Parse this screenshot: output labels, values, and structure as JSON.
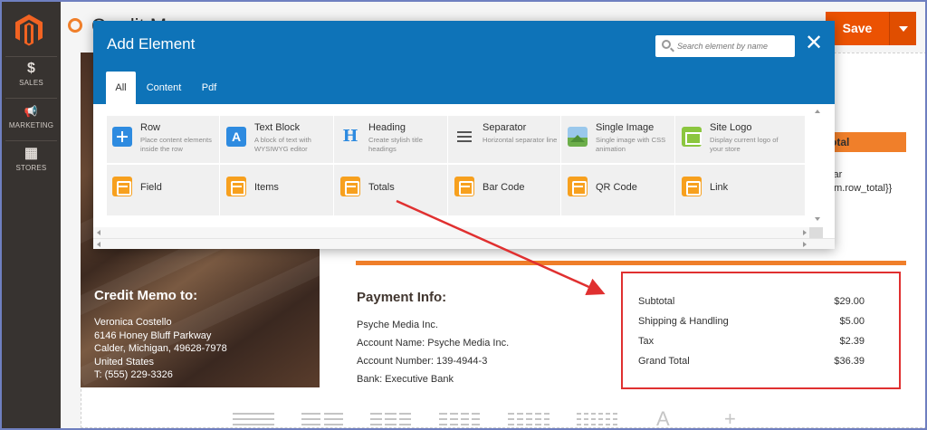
{
  "sidebar": {
    "items": [
      {
        "label": "SALES",
        "icon": "dollar-icon",
        "glyph": "$"
      },
      {
        "label": "MARKETING",
        "icon": "megaphone-icon",
        "glyph": "📢"
      },
      {
        "label": "STORES",
        "icon": "store-icon",
        "glyph": "▦"
      }
    ]
  },
  "header": {
    "title": "Credit Memo",
    "save_label": "Save"
  },
  "modal": {
    "title": "Add Element",
    "search_placeholder": "Search element by name",
    "close_glyph": "✕",
    "tabs": [
      {
        "label": "All",
        "active": true
      },
      {
        "label": "Content",
        "active": false
      },
      {
        "label": "Pdf",
        "active": false
      }
    ],
    "elements": [
      {
        "name": "Row",
        "desc": "Place content elements inside the row",
        "icon": "plus-icon"
      },
      {
        "name": "Text Block",
        "desc": "A block of text with WYSIWYG editor",
        "icon": "text-block-icon"
      },
      {
        "name": "Heading",
        "desc": "Create stylish title headings",
        "icon": "heading-icon"
      },
      {
        "name": "Separator",
        "desc": "Horizontal separator line",
        "icon": "separator-icon"
      },
      {
        "name": "Single Image",
        "desc": "Single image with CSS animation",
        "icon": "image-icon"
      },
      {
        "name": "Site Logo",
        "desc": "Display current logo of your store",
        "icon": "logo-icon"
      },
      {
        "name": "Field",
        "desc": "",
        "icon": "box-icon"
      },
      {
        "name": "Items",
        "desc": "",
        "icon": "box-icon"
      },
      {
        "name": "Totals",
        "desc": "",
        "icon": "box-icon"
      },
      {
        "name": "Bar Code",
        "desc": "",
        "icon": "box-icon"
      },
      {
        "name": "QR Code",
        "desc": "",
        "icon": "box-icon"
      },
      {
        "name": "Link",
        "desc": "",
        "icon": "box-icon"
      }
    ]
  },
  "canvas": {
    "total_tab": "otal",
    "code_lines": [
      "var",
      "em.row_total}}"
    ],
    "credit_memo_to": {
      "heading": "Credit Memo to:",
      "lines": [
        "Veronica Costello",
        "6146 Honey Bluff Parkway",
        "Calder, Michigan, 49628-7978",
        "United States",
        "T: (555) 229-3326"
      ]
    },
    "payment_info": {
      "heading": "Payment Info:",
      "lines": [
        "Psyche Media Inc.",
        "Account Name: Psyche Media Inc.",
        "Account Number: 139-4944-3",
        "Bank: Executive Bank"
      ]
    },
    "totals": [
      {
        "label": "Subtotal",
        "value": "$29.00"
      },
      {
        "label": "Shipping & Handling",
        "value": "$5.00"
      },
      {
        "label": "Tax",
        "value": "$2.39"
      },
      {
        "label": "Grand Total",
        "value": "$36.39"
      }
    ],
    "toolbar_text_glyph": "A",
    "toolbar_add_glyph": "+"
  },
  "colors": {
    "modal_header": "#0e73b8",
    "accent_orange": "#eb5202",
    "annotation_red": "#e03030"
  }
}
